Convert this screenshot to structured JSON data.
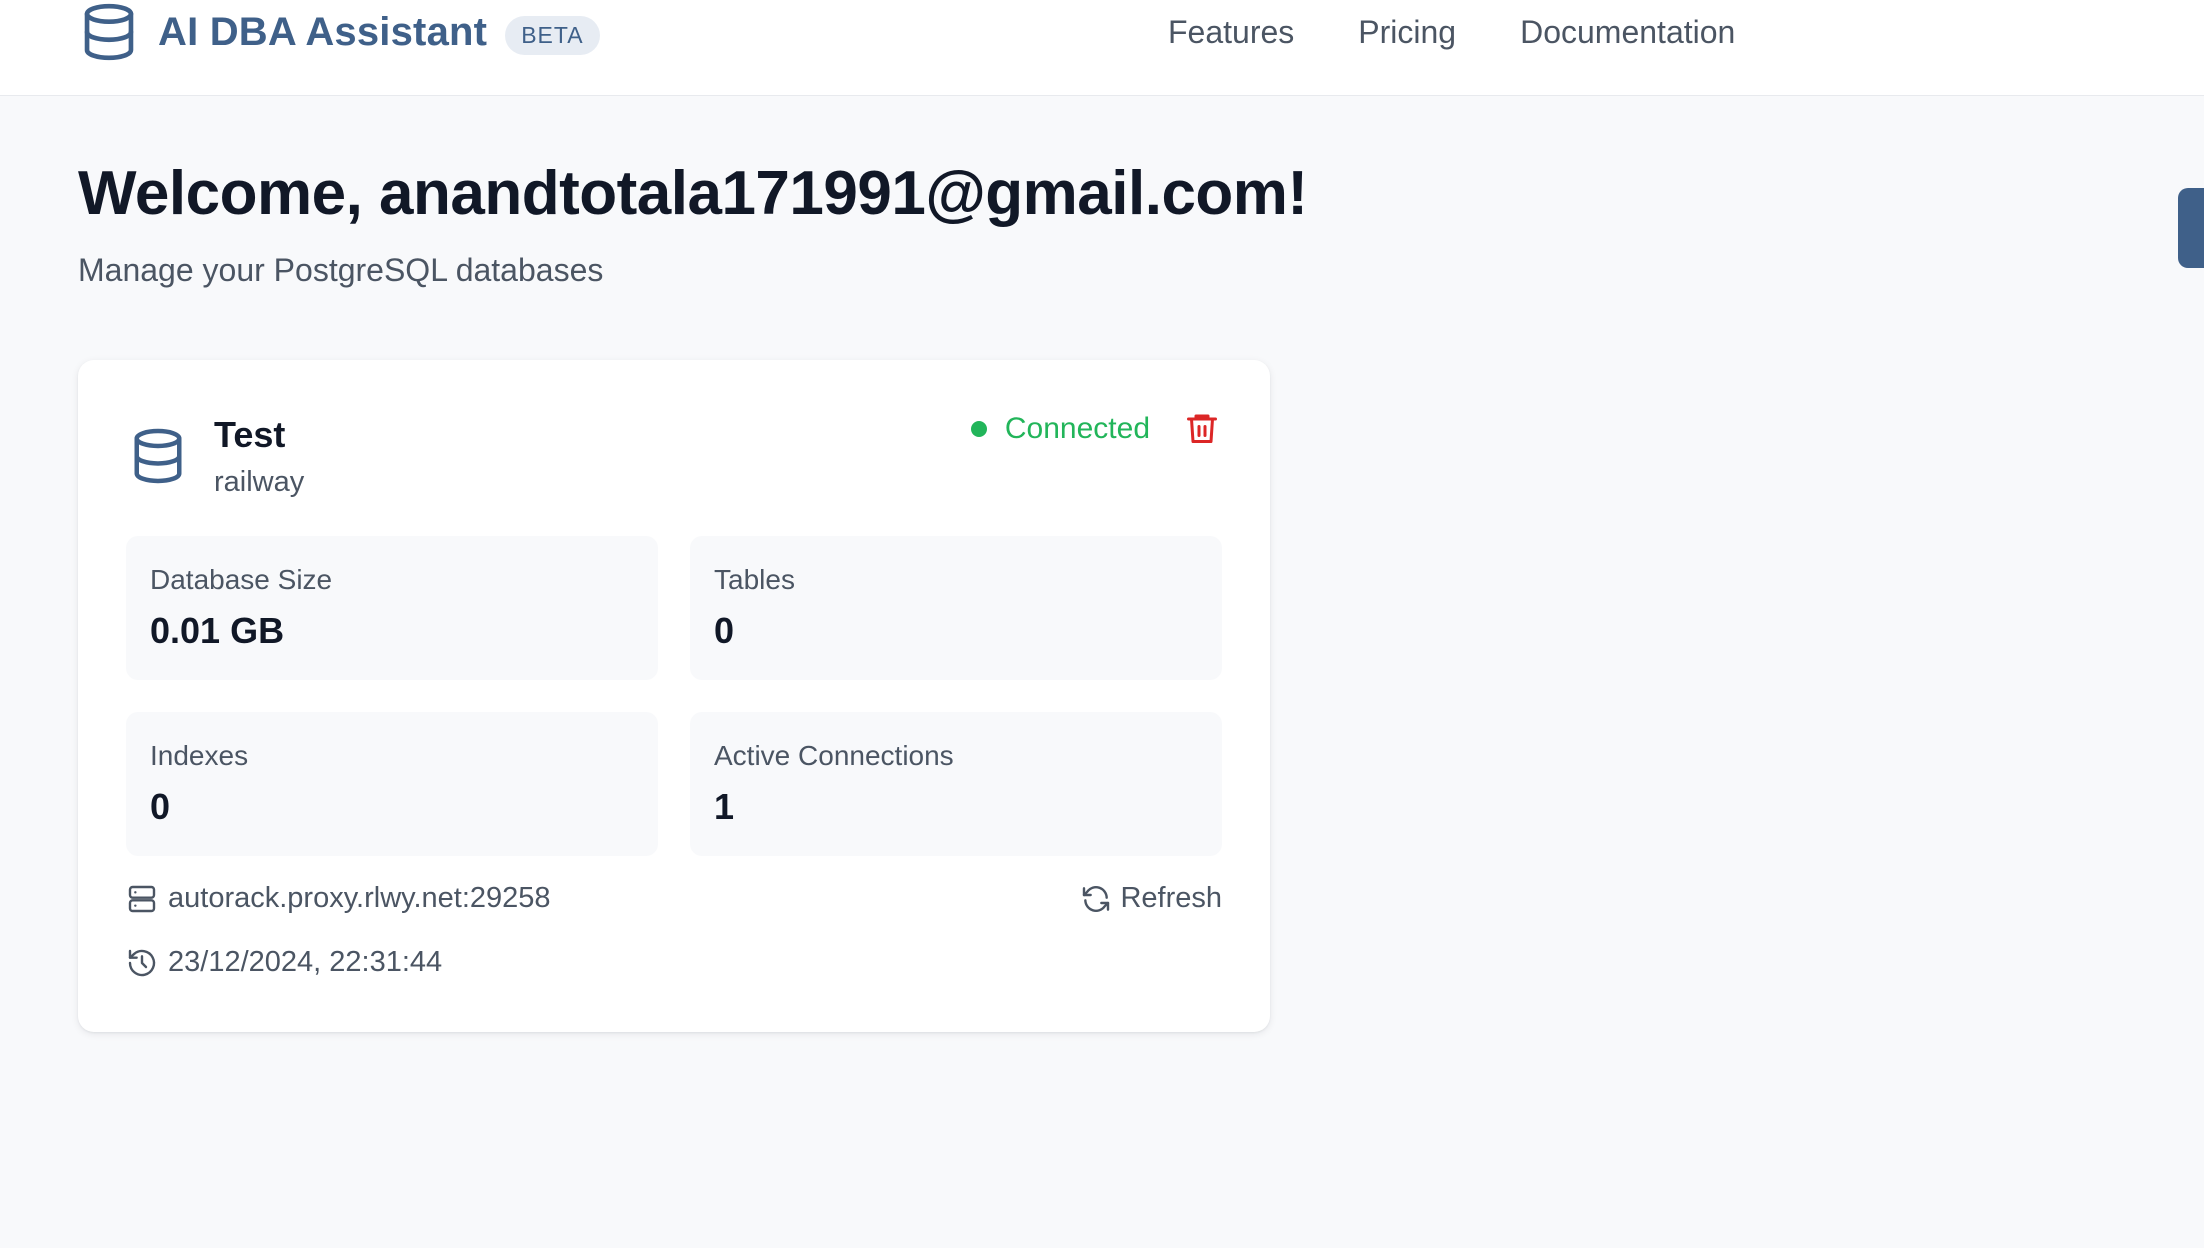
{
  "header": {
    "brand_title": "AI DBA Assistant",
    "badge": "BETA",
    "nav": [
      {
        "label": "Features"
      },
      {
        "label": "Pricing"
      },
      {
        "label": "Documentation"
      }
    ],
    "brand_icon": "database-icon",
    "accent_color": "#3f6089"
  },
  "page": {
    "welcome": "Welcome, anandtotala171991@gmail.com!",
    "subtitle": "Manage your PostgreSQL databases"
  },
  "database_card": {
    "name": "Test",
    "database": "railway",
    "status": "Connected",
    "status_color": "#22b55a",
    "delete_icon": "trash-icon",
    "delete_color": "#dc2626",
    "stats": [
      {
        "label": "Database Size",
        "value": "0.01 GB"
      },
      {
        "label": "Tables",
        "value": "0"
      },
      {
        "label": "Indexes",
        "value": "0"
      },
      {
        "label": "Active Connections",
        "value": "1"
      }
    ],
    "host": "autorack.proxy.rlwy.net:29258",
    "host_icon": "server-icon",
    "last_updated": "23/12/2024, 22:31:44",
    "time_icon": "history-icon",
    "refresh_label": "Refresh",
    "refresh_icon": "refresh-icon"
  }
}
